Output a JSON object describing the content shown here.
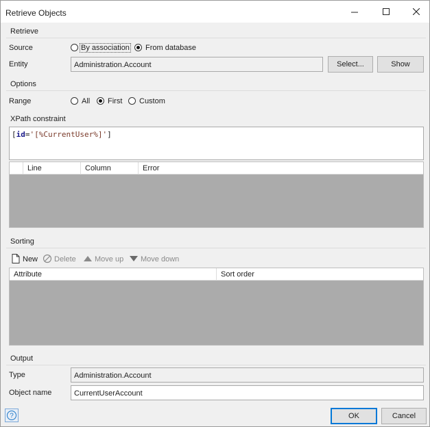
{
  "window": {
    "title": "Retrieve Objects"
  },
  "retrieve": {
    "section_label": "Retrieve",
    "source_label": "Source",
    "source_options": [
      "By association",
      "From database"
    ],
    "source_selected": "From database",
    "entity_label": "Entity",
    "entity_value": "Administration.Account",
    "select_button": "Select...",
    "show_button": "Show"
  },
  "options": {
    "section_label": "Options",
    "range_label": "Range",
    "range_options": [
      "All",
      "First",
      "Custom"
    ],
    "range_selected": "First"
  },
  "xpath": {
    "section_label": "XPath constraint",
    "open_bracket": "[",
    "keyword": "id",
    "equals": "=",
    "value": "'[%CurrentUser%]'",
    "close_bracket": "]",
    "error_columns": [
      "Line",
      "Column",
      "Error"
    ]
  },
  "sorting": {
    "section_label": "Sorting",
    "toolbar": {
      "new": "New",
      "delete": "Delete",
      "move_up": "Move up",
      "move_down": "Move down"
    },
    "columns": [
      "Attribute",
      "Sort order"
    ]
  },
  "output": {
    "section_label": "Output",
    "type_label": "Type",
    "type_value": "Administration.Account",
    "object_name_label": "Object name",
    "object_name_value": "CurrentUserAccount"
  },
  "footer": {
    "ok": "OK",
    "cancel": "Cancel"
  },
  "icons": {
    "help": "help-icon",
    "minimize": "minimize-icon",
    "maximize": "maximize-icon",
    "close": "close-icon",
    "new": "new-document-icon",
    "delete": "delete-icon",
    "move_up": "arrow-up-icon",
    "move_down": "arrow-down-icon"
  },
  "colors": {
    "grid_body": "#ababab",
    "accent": "#0078d7",
    "help_icon": "#1e78c8"
  }
}
